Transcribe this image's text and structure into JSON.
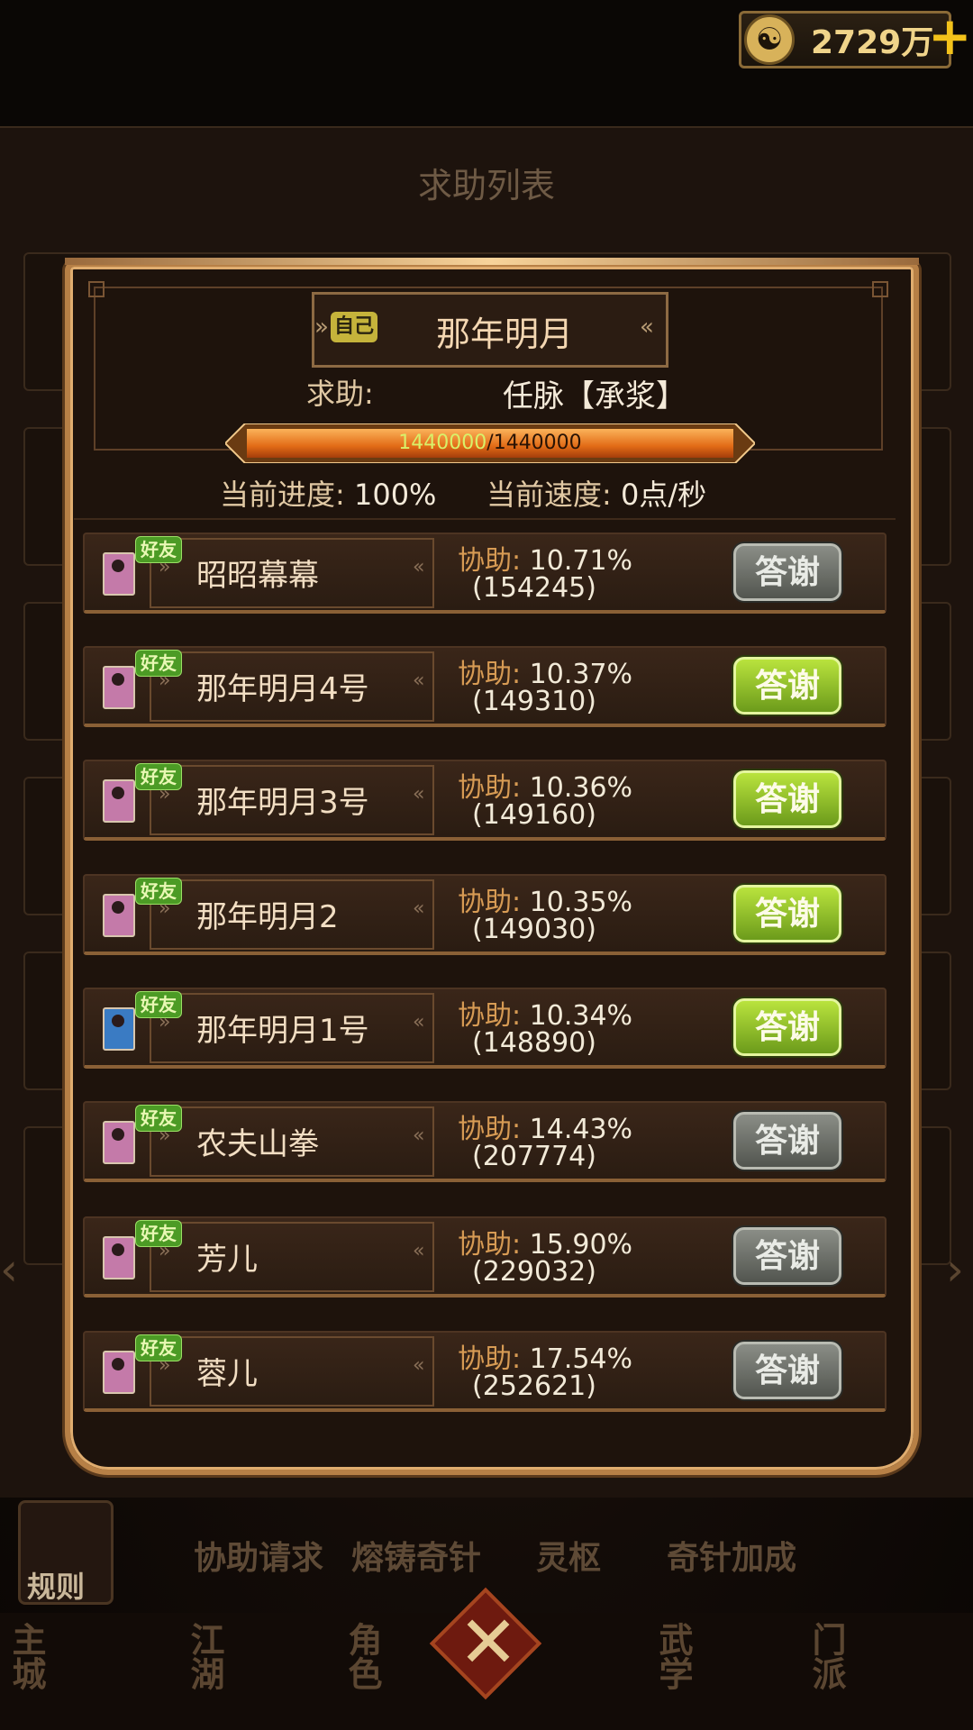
{
  "currency": {
    "value": "2729万",
    "icon": "yin-yang-coin-icon"
  },
  "background": {
    "title": "求助列表",
    "tabs": [
      "协助请求",
      "熔铸奇针",
      "灵枢",
      "奇针加成"
    ],
    "rule_label": "规则",
    "nav": [
      "主城",
      "江湖",
      "角色",
      "武学",
      "门派"
    ]
  },
  "modal": {
    "self_badge": "自己",
    "owner_name": "那年明月",
    "help_label": "求助:",
    "help_skill": "任脉【承浆】",
    "progress": {
      "current": "1440000",
      "total": "/1440000",
      "fraction": 1.0
    },
    "progress_label": "当前进度:",
    "progress_value": "100%",
    "speed_label": "当前速度:",
    "speed_value": "0点/秒"
  },
  "rows": [
    {
      "friend": "好友",
      "name": "昭昭幕幕",
      "assist_label": "协助:",
      "percent": "10.71%",
      "amount": "(154245)",
      "thanks": "答谢",
      "active": false,
      "avatar": "pink"
    },
    {
      "friend": "好友",
      "name": "那年明月4号",
      "assist_label": "协助:",
      "percent": "10.37%",
      "amount": "(149310)",
      "thanks": "答谢",
      "active": true,
      "avatar": "pink"
    },
    {
      "friend": "好友",
      "name": "那年明月3号",
      "assist_label": "协助:",
      "percent": "10.36%",
      "amount": "(149160)",
      "thanks": "答谢",
      "active": true,
      "avatar": "pink"
    },
    {
      "friend": "好友",
      "name": "那年明月2",
      "assist_label": "协助:",
      "percent": "10.35%",
      "amount": "(149030)",
      "thanks": "答谢",
      "active": true,
      "avatar": "pink"
    },
    {
      "friend": "好友",
      "name": "那年明月1号",
      "assist_label": "协助:",
      "percent": "10.34%",
      "amount": "(148890)",
      "thanks": "答谢",
      "active": true,
      "avatar": "blue"
    },
    {
      "friend": "好友",
      "name": "农夫山拳",
      "assist_label": "协助:",
      "percent": "14.43%",
      "amount": "(207774)",
      "thanks": "答谢",
      "active": false,
      "avatar": "pink"
    },
    {
      "friend": "好友",
      "name": "芳儿",
      "assist_label": "协助:",
      "percent": "15.90%",
      "amount": "(229032)",
      "thanks": "答谢",
      "active": false,
      "avatar": "pink"
    },
    {
      "friend": "好友",
      "name": "蓉儿",
      "assist_label": "协助:",
      "percent": "17.54%",
      "amount": "(252621)",
      "thanks": "答谢",
      "active": false,
      "avatar": "pink"
    }
  ]
}
